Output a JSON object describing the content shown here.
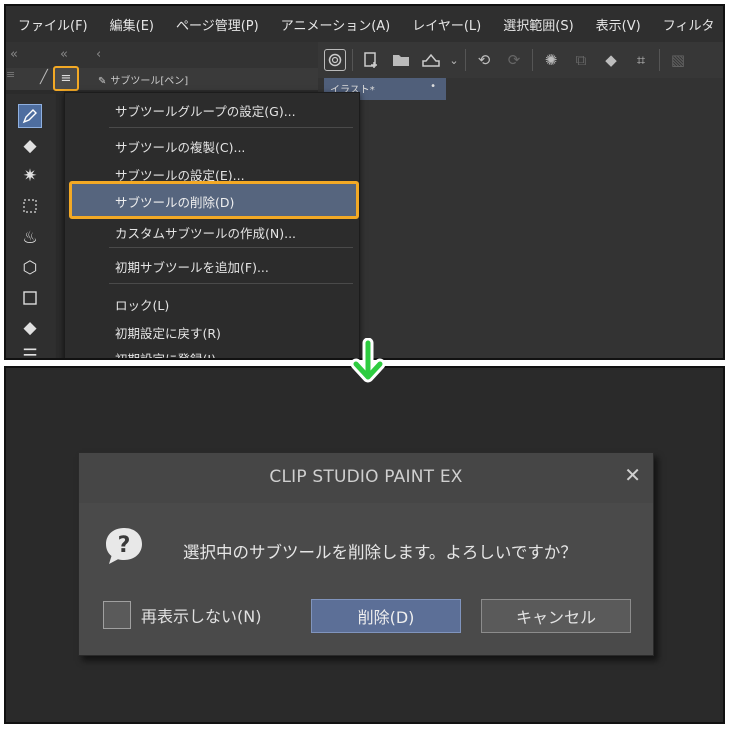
{
  "menubar": {
    "items": [
      "ファイル(F)",
      "編集(E)",
      "ページ管理(P)",
      "アニメーション(A)",
      "レイヤー(L)",
      "選択範囲(S)",
      "表示(V)",
      "フィルタ"
    ]
  },
  "panel_nav": {
    "collapse_left": "«",
    "collapse_mid": "«",
    "back": "‹"
  },
  "subtool": {
    "title": "サブツール[ペン]"
  },
  "document_tab": {
    "label": "イラスト*",
    "dot": "•"
  },
  "dropdown": {
    "items": [
      "サブツールグループの設定(G)...",
      "サブツールの複製(C)...",
      "サブツールの設定(E)...",
      "サブツールの削除(D)",
      "カスタムサブツールの作成(N)...",
      "初期サブツールを追加(F)...",
      "ロック(L)",
      "初期設定に戻す(R)",
      "初期設定に登録(I)"
    ]
  },
  "dialog": {
    "title": "CLIP STUDIO PAINT EX",
    "message": "選択中のサブツールを削除します。よろしいですか？",
    "checkbox_label": "再表示しない(N)",
    "delete_button": "削除(D)",
    "cancel_button": "キャンセル",
    "close_glyph": "✕"
  },
  "colors": {
    "highlight": "#f3a925",
    "arrow": "#2ecc40",
    "primary_button": "#5c6f97"
  }
}
